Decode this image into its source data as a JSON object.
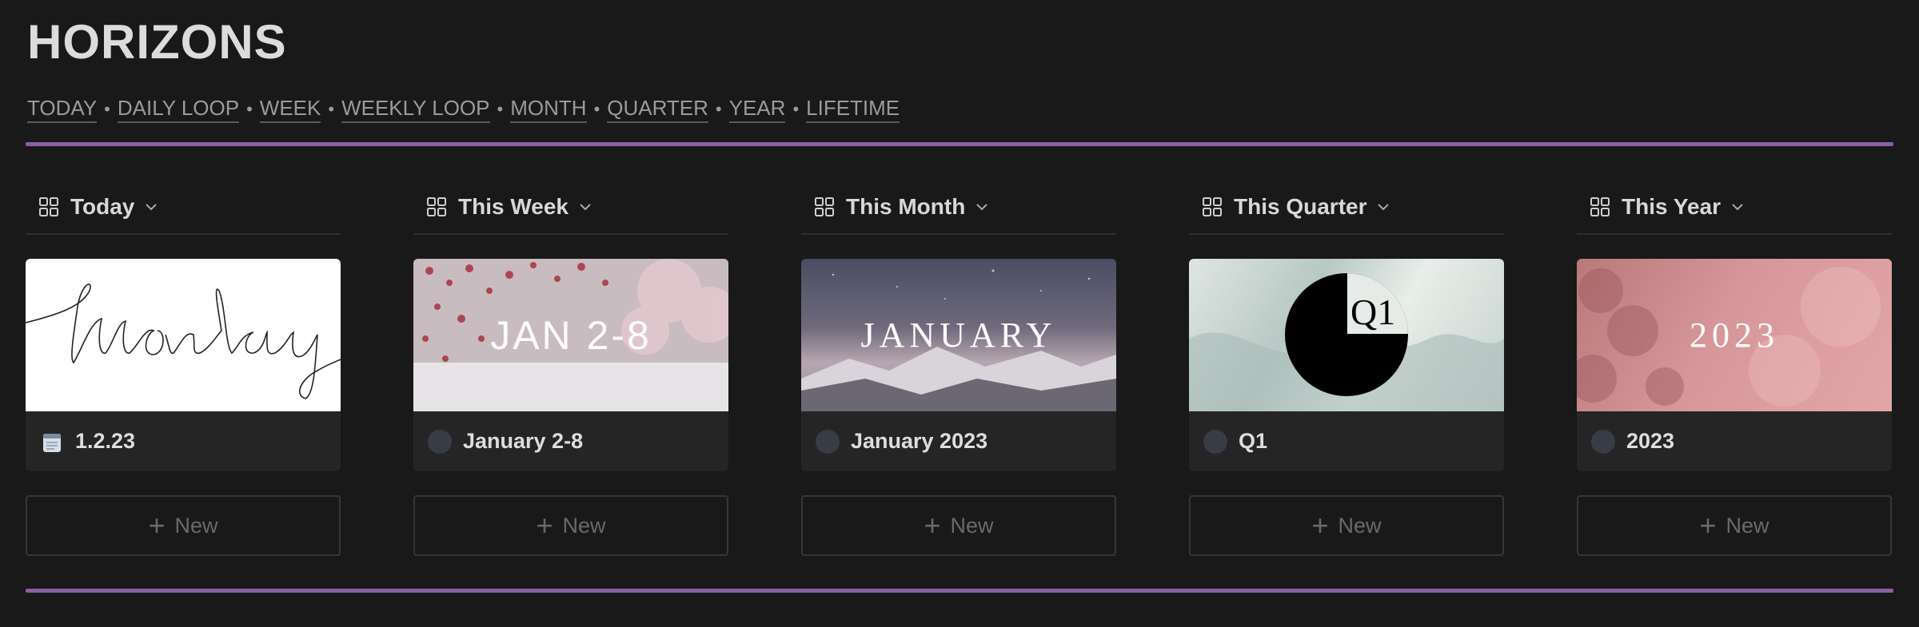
{
  "title": "HORIZONS",
  "nav": [
    "TODAY",
    "DAILY LOOP",
    "WEEK",
    "WEEKLY LOOP",
    "MONTH",
    "QUARTER",
    "YEAR",
    "LIFETIME"
  ],
  "nav_separator": "•",
  "colors": {
    "accent": "#8c5fa3",
    "background": "#191919",
    "card": "#252525"
  },
  "boards": [
    {
      "view": "Today",
      "cover_text": "Monday",
      "card_title": "1.2.23",
      "card_icon": "notepad-icon",
      "new_label": "New"
    },
    {
      "view": "This Week",
      "cover_text": "JAN 2-8",
      "card_title": "January 2-8",
      "card_icon": "circle-icon",
      "new_label": "New"
    },
    {
      "view": "This Month",
      "cover_text": "JANUARY",
      "card_title": "January 2023",
      "card_icon": "circle-icon",
      "new_label": "New"
    },
    {
      "view": "This Quarter",
      "cover_text": "Q1",
      "card_title": "Q1",
      "card_icon": "circle-icon",
      "new_label": "New"
    },
    {
      "view": "This Year",
      "cover_text": "2023",
      "card_title": "2023",
      "card_icon": "circle-icon",
      "new_label": "New"
    }
  ]
}
